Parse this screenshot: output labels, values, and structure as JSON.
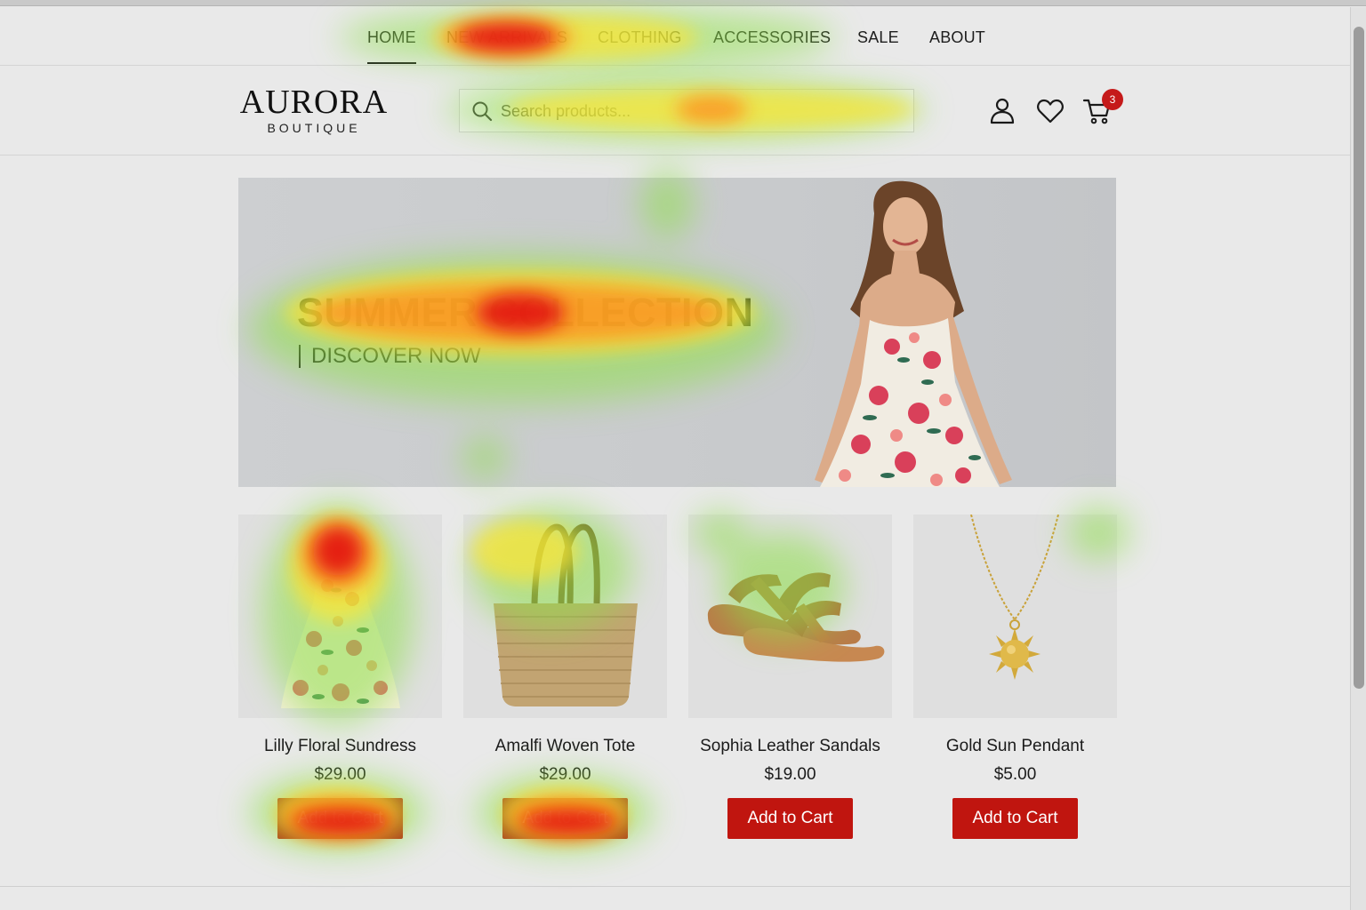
{
  "nav": {
    "items": [
      {
        "label": "HOME",
        "active": true
      },
      {
        "label": "NEW ARRIVALS"
      },
      {
        "label": "CLOTHING"
      },
      {
        "label": "ACCESSORIES"
      },
      {
        "label": "SALE"
      },
      {
        "label": "ABOUT"
      }
    ]
  },
  "header": {
    "logo_main": "AURORA",
    "logo_sub": "BOUTIQUE",
    "search_placeholder": "Search products...",
    "icons": [
      "user-icon",
      "heart-icon",
      "cart-icon"
    ],
    "cart_count": "3"
  },
  "hero": {
    "title": "SUMMER COLLECTION",
    "cta": "DISCOVER NOW"
  },
  "products": [
    {
      "name": "Lilly Floral Sundress",
      "price": "$29.00",
      "button": "Add to Cart",
      "image": "floral-dress"
    },
    {
      "name": "Amalfi Woven Tote",
      "price": "$29.00",
      "button": "Add to Cart",
      "image": "woven-tote"
    },
    {
      "name": "Sophia Leather Sandals",
      "price": "$19.00",
      "button": "Add to Cart",
      "image": "leather-sandals"
    },
    {
      "name": "Gold Sun Pendant",
      "price": "$5.00",
      "button": "Add to Cart",
      "image": "sun-pendant"
    }
  ],
  "colors": {
    "accent_button": "#c0150f",
    "badge": "#c51a1a",
    "background": "#e9e9e9"
  }
}
